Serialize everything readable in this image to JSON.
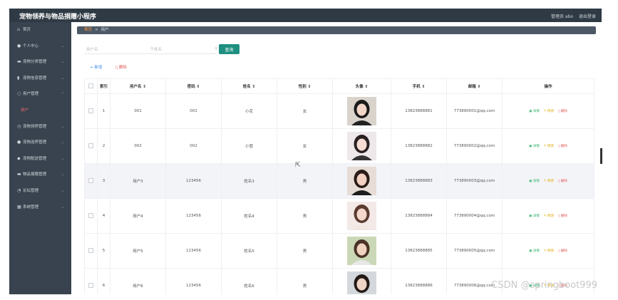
{
  "app": {
    "title": "宠物领养与物品捐赠小程序",
    "user_label": "管理员 abo",
    "logout": "退出登录"
  },
  "sidebar": {
    "items": [
      {
        "icon": "⌂",
        "icon_name": "home-icon",
        "label": "首页",
        "chev": ""
      },
      {
        "icon": "●",
        "icon_name": "user-icon",
        "label": "个人中心",
        "chev": "⌄"
      },
      {
        "icon": "▬",
        "icon_name": "category-icon",
        "label": "宠物分类管理",
        "chev": "⌄"
      },
      {
        "icon": "▮",
        "icon_name": "document-icon",
        "label": "宠物信息管理",
        "chev": "⌄"
      },
      {
        "icon": "○",
        "icon_name": "users-icon",
        "label": "用户管理",
        "chev": "⌃"
      },
      {
        "icon": "",
        "icon_name": "",
        "label": "用户",
        "chev": ""
      },
      {
        "icon": "◷",
        "icon_name": "adopt-icon",
        "label": "宠物领养管理",
        "chev": "⌄"
      },
      {
        "icon": "●",
        "icon_name": "rescue-icon",
        "label": "宠物送养管理",
        "chev": "⌄"
      },
      {
        "icon": "◆",
        "icon_name": "location-icon",
        "label": "宠物配送管理",
        "chev": "⌄"
      },
      {
        "icon": "▬",
        "icon_name": "donation-icon",
        "label": "物品捐赠管理",
        "chev": "⌄"
      },
      {
        "icon": "◔",
        "icon_name": "forum-icon",
        "label": "论坛管理",
        "chev": "⌄"
      },
      {
        "icon": "▦",
        "icon_name": "settings-icon",
        "label": "系统管理",
        "chev": "⌄"
      }
    ]
  },
  "breadcrumb": {
    "home": "首页",
    "sep": "×",
    "current": "用户"
  },
  "search": {
    "username_placeholder": "用户名",
    "name_placeholder": "姓名",
    "button": "查询"
  },
  "toolbar": {
    "add": "+ 新增",
    "delete": "▯ 删除"
  },
  "table": {
    "headers": [
      "",
      "索引",
      "用户名 ⇕",
      "密码 ⇕",
      "姓名 ⇕",
      "性别 ⇕",
      "头像 ⇕",
      "手机 ⇕",
      "邮箱 ⇕",
      "操作"
    ],
    "rows": [
      {
        "index": "1",
        "username": "001",
        "password": "001",
        "name": "小花",
        "gender": "女",
        "phone": "13823888881",
        "email": "773890001@qq.com"
      },
      {
        "index": "2",
        "username": "002",
        "password": "002",
        "name": "小慧",
        "gender": "女",
        "phone": "13823888882",
        "email": "773890002@qq.com"
      },
      {
        "index": "3",
        "username": "用户3",
        "password": "123456",
        "name": "姓名3",
        "gender": "男",
        "phone": "13823888883",
        "email": "773890003@qq.com"
      },
      {
        "index": "4",
        "username": "用户4",
        "password": "123456",
        "name": "姓名4",
        "gender": "男",
        "phone": "13823888884",
        "email": "773890004@qq.com"
      },
      {
        "index": "5",
        "username": "用户5",
        "password": "123456",
        "name": "姓名5",
        "gender": "男",
        "phone": "13823888885",
        "email": "773890005@qq.com"
      },
      {
        "index": "6",
        "username": "用户6",
        "password": "123456",
        "name": "姓名6",
        "gender": "男",
        "phone": "13823888886",
        "email": "773890006@qq.com"
      }
    ],
    "actions": {
      "detail": "▣ 详情",
      "edit": "✎ 修改",
      "delete": "▯ 删除"
    }
  },
  "watermark": "CSDN @springboot999",
  "colors": {
    "header": "#2f3a45",
    "sidebar": "#39434f",
    "accent": "#1e8f80",
    "danger": "#e05a5a",
    "edit": "#e0a800",
    "detail": "#2fb36b"
  }
}
